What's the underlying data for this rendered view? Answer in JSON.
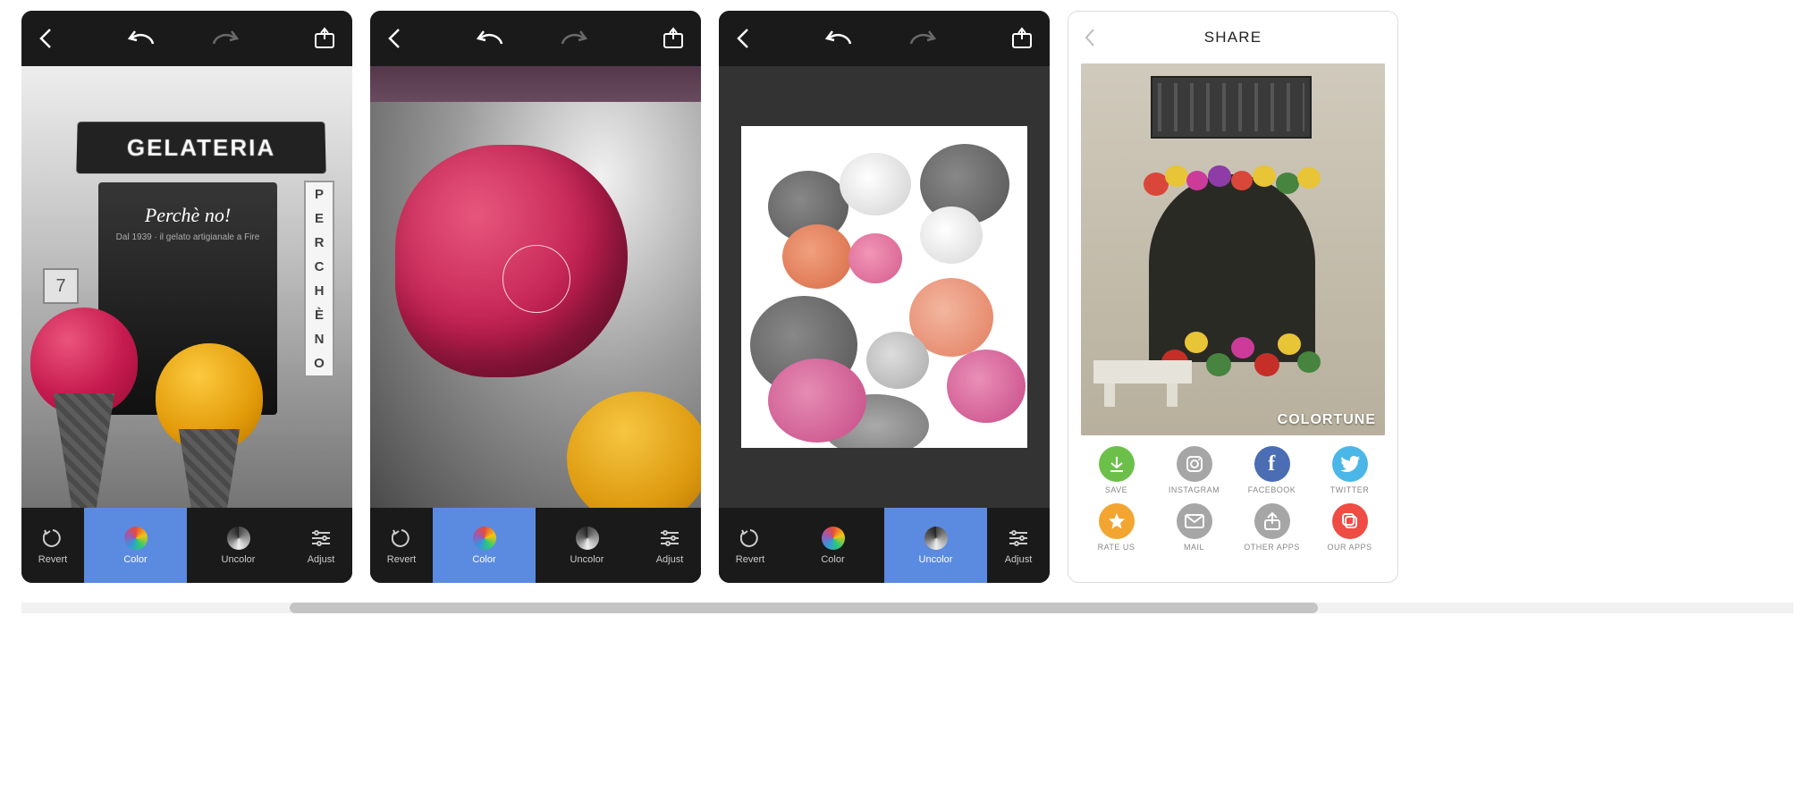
{
  "editor": {
    "topbar": {
      "back": "back",
      "undo": "undo",
      "redo": "redo",
      "share": "share"
    },
    "tools": {
      "revert": "Revert",
      "color": "Color",
      "uncolor": "Uncolor",
      "adjust": "Adjust"
    },
    "screens": [
      {
        "selected_tool": "color",
        "image": {
          "sign": "GELATERIA",
          "neon": "Perchè no!",
          "subtext": "Dal 1939 · il gelato artigianale a Fire",
          "vertical_sign": [
            "P",
            "E",
            "R",
            "C",
            "H",
            "È",
            "N",
            "O"
          ],
          "house_number": "7"
        }
      },
      {
        "selected_tool": "color",
        "image": {
          "desc": "pink gelato close-up with brush target"
        }
      },
      {
        "selected_tool": "uncolor",
        "image": {
          "desc": "bouquet of roses and carnations, selective color"
        }
      }
    ]
  },
  "share": {
    "title": "SHARE",
    "watermark": "COLORTUNE",
    "items": [
      {
        "key": "save",
        "label": "SAVE",
        "color": "#6cc04a"
      },
      {
        "key": "instagram",
        "label": "INSTAGRAM",
        "color": "#a6a6a6"
      },
      {
        "key": "facebook",
        "label": "FACEBOOK",
        "color": "#4a6db3"
      },
      {
        "key": "twitter",
        "label": "TWITTER",
        "color": "#4bb7e8"
      },
      {
        "key": "rateus",
        "label": "RATE US",
        "color": "#f2a531"
      },
      {
        "key": "mail",
        "label": "MAIL",
        "color": "#a6a6a6"
      },
      {
        "key": "otherapps",
        "label": "OTHER APPS",
        "color": "#a6a6a6"
      },
      {
        "key": "ourapps",
        "label": "OUR APPS",
        "color": "#ef4c44"
      }
    ]
  }
}
